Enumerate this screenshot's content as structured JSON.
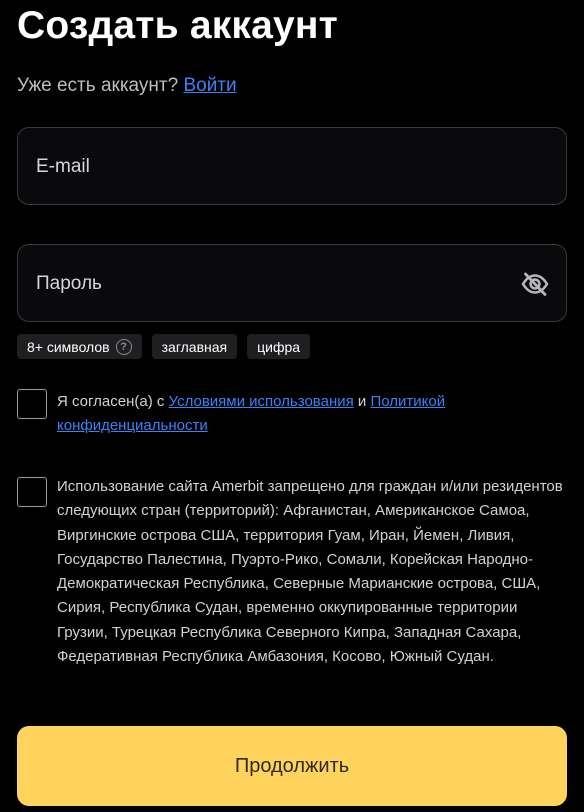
{
  "header": {
    "title": "Создать аккаунт",
    "have_account_text": "Уже есть аккаунт?",
    "login_link": "Войти"
  },
  "form": {
    "email_placeholder": "E-mail",
    "password_placeholder": "Пароль",
    "password_toggle_icon": "eye-off-icon"
  },
  "password_rules": {
    "min_length": "8+ символов",
    "help_icon": "?",
    "uppercase": "заглавная",
    "digit": "цифра"
  },
  "agreement": {
    "checked": false,
    "prefix": "Я согласен(а) с",
    "terms_link": "Условиями использования",
    "and": "и",
    "privacy_link": "Политикой конфиденциальности"
  },
  "restriction": {
    "checked": false,
    "text": "Использование сайта Amerbit запрещено для граждан и/или резидентов следующих стран (территорий): Афганистан, Американское Самоа, Виргинские острова США, территория Гуам, Иран, Йемен, Ливия, Государство Палестина, Пуэрто-Рико, Сомали, Корейская Народно-Демократическая Республика, Северные Марианские острова, США, Сирия, Республика Судан, временно оккупированные территории Грузии, Турецкая Республика Северного Кипра, Западная Сахара, Федеративная Республика Амбазония, Косово, Южный Судан."
  },
  "actions": {
    "continue_label": "Продолжить"
  },
  "colors": {
    "background": "#000000",
    "accent_button": "#ffd35c",
    "link": "#3b82f6",
    "field_border": "#3a3a3e"
  }
}
